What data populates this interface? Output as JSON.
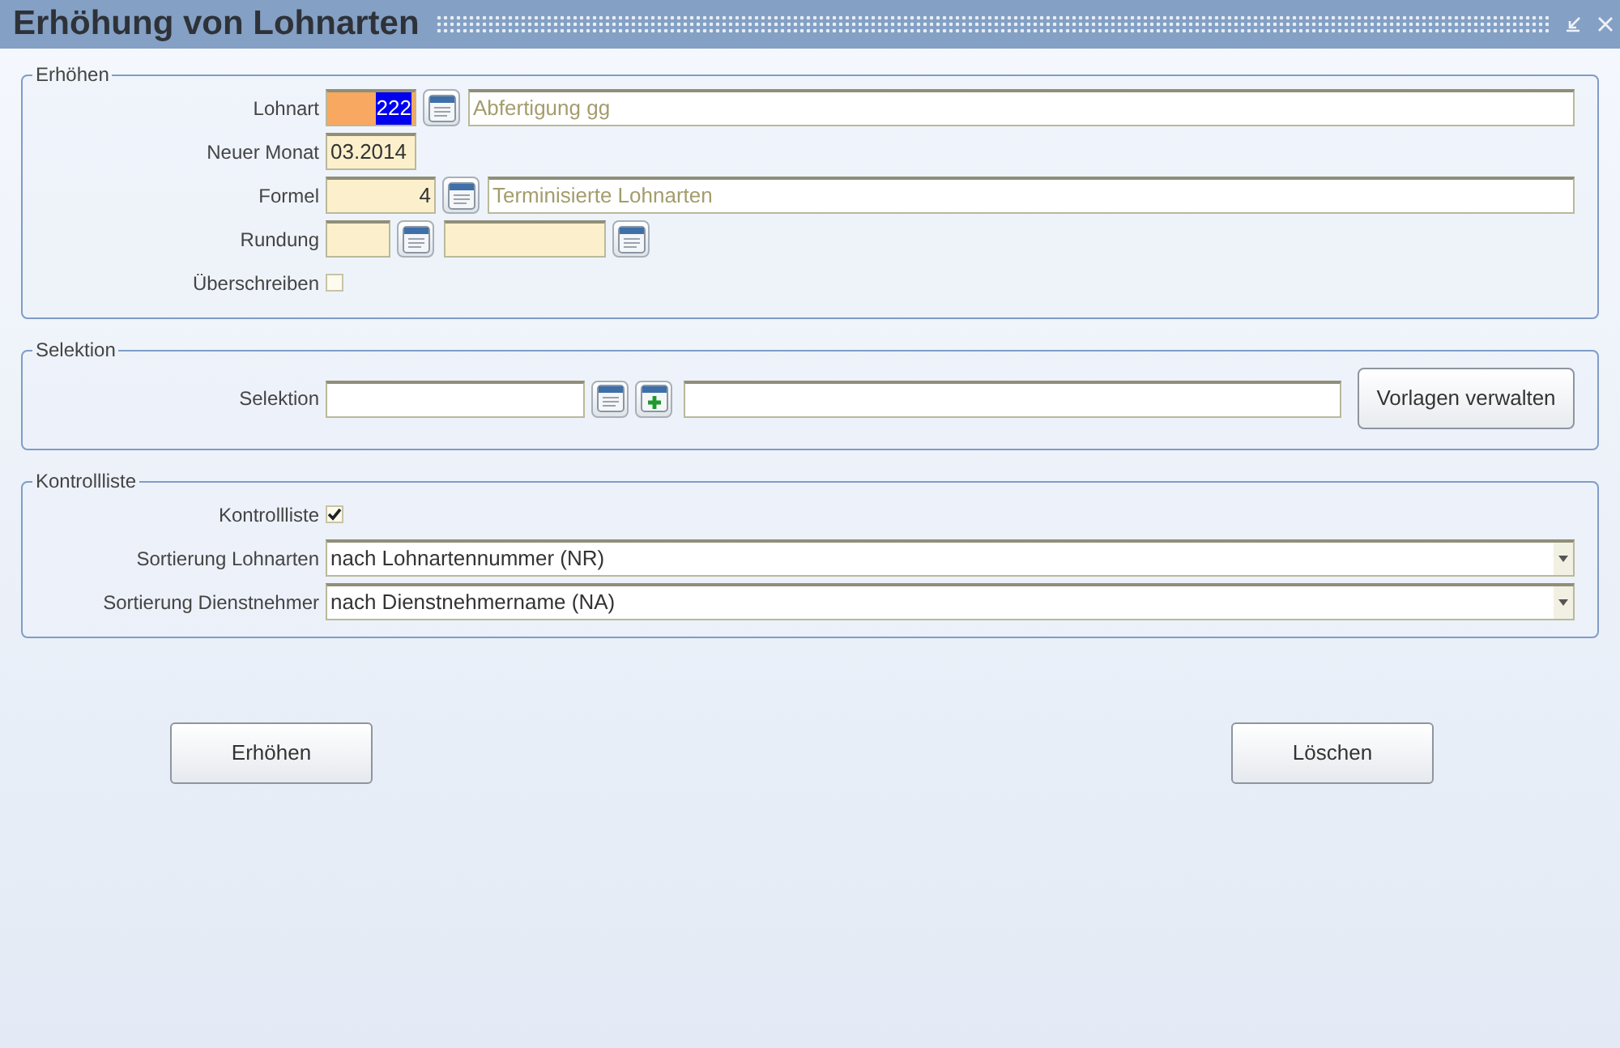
{
  "window": {
    "title": "Erhöhung von Lohnarten"
  },
  "groups": [
    {
      "title": "Erhöhen",
      "rows": [
        {
          "kind": "lookup",
          "label": "Lohnart",
          "code": "222",
          "focused": true,
          "description": "Abfertigung gg"
        },
        {
          "kind": "text",
          "label": "Neuer Monat",
          "value": "03.2014"
        },
        {
          "kind": "lookup",
          "label": "Formel",
          "code": "4",
          "focused": false,
          "description": "Terminisierte Lohnarten"
        },
        {
          "kind": "lookup_short",
          "label": "Rundung"
        },
        {
          "kind": "checkbox",
          "label": "Überschreiben",
          "checked": false
        }
      ]
    },
    {
      "title": "Selektion",
      "rows": [
        {
          "kind": "selection",
          "label": "Selektion",
          "button": "Vorlagen verwalten"
        }
      ]
    },
    {
      "title": "Kontrollliste",
      "rows": [
        {
          "kind": "checkbox",
          "label": "Kontrollliste",
          "checked": true
        },
        {
          "kind": "dropdown",
          "label": "Sortierung Lohnarten",
          "value": "nach Lohnartennummer (NR)"
        },
        {
          "kind": "dropdown",
          "label": "Sortierung Dienstnehmer",
          "value": "nach Dienstnehmername (NA)"
        }
      ]
    }
  ],
  "buttons": [
    "Erhöhen",
    "Löschen"
  ]
}
